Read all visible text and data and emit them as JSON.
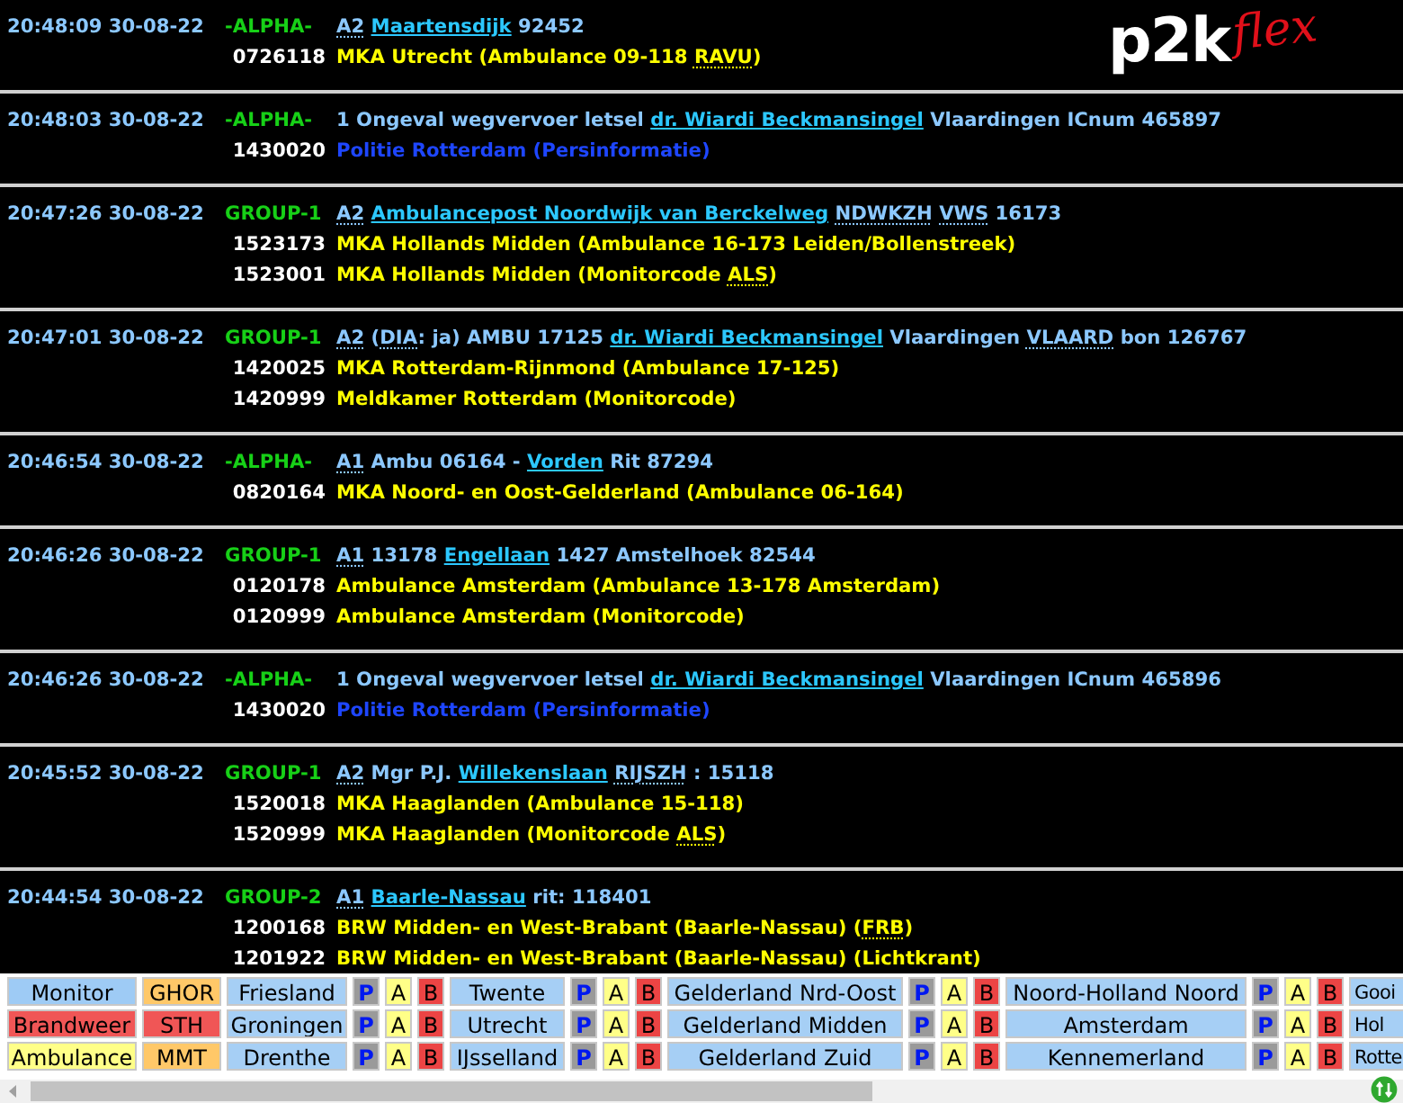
{
  "logo": {
    "main": "p2k",
    "accent": "flex"
  },
  "messages": [
    {
      "time": "20:48:09 30-08-22",
      "group": "-ALPHA-",
      "segments": [
        {
          "kind": "abbr",
          "text": "A2"
        },
        {
          "kind": "link",
          "text": "Maartensdijk"
        },
        {
          "kind": "text",
          "text": "92452"
        }
      ],
      "recipients": [
        {
          "code": "0726118",
          "color": "#ffff00",
          "segments": [
            {
              "kind": "text",
              "text": "MKA Utrecht (Ambulance 09-118"
            },
            {
              "kind": "abbr",
              "text": "RAVU",
              "after": ")"
            }
          ]
        }
      ]
    },
    {
      "time": "20:48:03 30-08-22",
      "group": "-ALPHA-",
      "segments": [
        {
          "kind": "text",
          "text": "1 Ongeval wegvervoer letsel"
        },
        {
          "kind": "link",
          "text": "dr. Wiardi Beckmansingel"
        },
        {
          "kind": "text",
          "text": "Vlaardingen ICnum 465897"
        }
      ],
      "recipients": [
        {
          "code": "1430020",
          "color": "#1e46ff",
          "segments": [
            {
              "kind": "text",
              "text": "Politie Rotterdam (Persinformatie)"
            }
          ]
        }
      ]
    },
    {
      "time": "20:47:26 30-08-22",
      "group": "GROUP-1",
      "segments": [
        {
          "kind": "abbr",
          "text": "A2"
        },
        {
          "kind": "link",
          "text": "Ambulancepost Noordwijk van Berckelweg"
        },
        {
          "kind": "abbr",
          "text": "NDWKZH"
        },
        {
          "kind": "abbr",
          "text": "VWS"
        },
        {
          "kind": "text",
          "text": "16173"
        }
      ],
      "recipients": [
        {
          "code": "1523173",
          "color": "#ffff00",
          "segments": [
            {
              "kind": "text",
              "text": "MKA Hollands Midden (Ambulance 16-173 Leiden/Bollenstreek)"
            }
          ]
        },
        {
          "code": "1523001",
          "color": "#ffff00",
          "segments": [
            {
              "kind": "text",
              "text": "MKA Hollands Midden (Monitorcode"
            },
            {
              "kind": "abbr",
              "text": "ALS",
              "after": ")"
            }
          ]
        }
      ]
    },
    {
      "time": "20:47:01 30-08-22",
      "group": "GROUP-1",
      "segments": [
        {
          "kind": "abbr",
          "text": "A2"
        },
        {
          "kind": "abbr",
          "text": "DIA",
          "before": "(",
          "after": ": ja) AMBU 17125"
        },
        {
          "kind": "link",
          "text": "dr. Wiardi Beckmansingel"
        },
        {
          "kind": "text",
          "text": "Vlaardingen"
        },
        {
          "kind": "abbr",
          "text": "VLAARD"
        },
        {
          "kind": "text",
          "text": "bon 126767"
        }
      ],
      "recipients": [
        {
          "code": "1420025",
          "color": "#ffff00",
          "segments": [
            {
              "kind": "text",
              "text": "MKA Rotterdam-Rijnmond (Ambulance 17-125)"
            }
          ]
        },
        {
          "code": "1420999",
          "color": "#ffff00",
          "segments": [
            {
              "kind": "text",
              "text": "Meldkamer Rotterdam (Monitorcode)"
            }
          ]
        }
      ]
    },
    {
      "time": "20:46:54 30-08-22",
      "group": "-ALPHA-",
      "segments": [
        {
          "kind": "abbr",
          "text": "A1"
        },
        {
          "kind": "text",
          "text": "Ambu 06164 -"
        },
        {
          "kind": "link",
          "text": "Vorden"
        },
        {
          "kind": "text",
          "text": "Rit 87294"
        }
      ],
      "recipients": [
        {
          "code": "0820164",
          "color": "#ffff00",
          "segments": [
            {
              "kind": "text",
              "text": "MKA Noord- en Oost-Gelderland (Ambulance 06-164)"
            }
          ]
        }
      ]
    },
    {
      "time": "20:46:26 30-08-22",
      "group": "GROUP-1",
      "segments": [
        {
          "kind": "abbr",
          "text": "A1"
        },
        {
          "kind": "text",
          "text": "13178"
        },
        {
          "kind": "link",
          "text": "Engellaan"
        },
        {
          "kind": "text",
          "text": "1427 Amstelhoek 82544"
        }
      ],
      "recipients": [
        {
          "code": "0120178",
          "color": "#ffff00",
          "segments": [
            {
              "kind": "text",
              "text": "Ambulance Amsterdam (Ambulance 13-178 Amsterdam)"
            }
          ]
        },
        {
          "code": "0120999",
          "color": "#ffff00",
          "segments": [
            {
              "kind": "text",
              "text": "Ambulance Amsterdam (Monitorcode)"
            }
          ]
        }
      ]
    },
    {
      "time": "20:46:26 30-08-22",
      "group": "-ALPHA-",
      "segments": [
        {
          "kind": "text",
          "text": "1 Ongeval wegvervoer letsel"
        },
        {
          "kind": "link",
          "text": "dr. Wiardi Beckmansingel"
        },
        {
          "kind": "text",
          "text": "Vlaardingen ICnum 465896"
        }
      ],
      "recipients": [
        {
          "code": "1430020",
          "color": "#1e46ff",
          "segments": [
            {
              "kind": "text",
              "text": "Politie Rotterdam (Persinformatie)"
            }
          ]
        }
      ]
    },
    {
      "time": "20:45:52 30-08-22",
      "group": "GROUP-1",
      "segments": [
        {
          "kind": "abbr",
          "text": "A2"
        },
        {
          "kind": "text",
          "text": "Mgr P.J."
        },
        {
          "kind": "link",
          "text": "Willekenslaan"
        },
        {
          "kind": "abbr",
          "text": "RIJSZH"
        },
        {
          "kind": "text",
          "text": ": 15118"
        }
      ],
      "recipients": [
        {
          "code": "1520018",
          "color": "#ffff00",
          "segments": [
            {
              "kind": "text",
              "text": "MKA Haaglanden (Ambulance 15-118)"
            }
          ]
        },
        {
          "code": "1520999",
          "color": "#ffff00",
          "segments": [
            {
              "kind": "text",
              "text": "MKA Haaglanden (Monitorcode"
            },
            {
              "kind": "abbr",
              "text": "ALS",
              "after": ")"
            }
          ]
        }
      ]
    },
    {
      "time": "20:44:54 30-08-22",
      "group": "GROUP-2",
      "segments": [
        {
          "kind": "abbr",
          "text": "A1"
        },
        {
          "kind": "link",
          "text": "Baarle-Nassau"
        },
        {
          "kind": "text",
          "text": "rit: 118401"
        }
      ],
      "recipients": [
        {
          "code": "1200168",
          "color": "#ffff00",
          "segments": [
            {
              "kind": "text",
              "text": "BRW Midden- en West-Brabant (Baarle-Nassau)"
            },
            {
              "kind": "abbr",
              "text": "FRB",
              "before": "(",
              "after": ")"
            }
          ]
        },
        {
          "code": "1201922",
          "color": "#ffff00",
          "segments": [
            {
              "kind": "text",
              "text": "BRW Midden- en West-Brabant (Baarle-Nassau) (Lichtkrant)"
            }
          ]
        }
      ]
    }
  ],
  "filters": [
    [
      {
        "kind": "monitor",
        "label": "Monitor"
      },
      {
        "kind": "ghor",
        "label": "GHOR"
      },
      {
        "kind": "region",
        "label": "Friesland"
      },
      {
        "kind": "p",
        "label": "P"
      },
      {
        "kind": "a",
        "label": "A"
      },
      {
        "kind": "b",
        "label": "B"
      },
      {
        "kind": "region",
        "label": "Twente"
      },
      {
        "kind": "p",
        "label": "P"
      },
      {
        "kind": "a",
        "label": "A"
      },
      {
        "kind": "b",
        "label": "B"
      },
      {
        "kind": "region",
        "label": "Gelderland Nrd-Oost"
      },
      {
        "kind": "p",
        "label": "P"
      },
      {
        "kind": "a",
        "label": "A"
      },
      {
        "kind": "b",
        "label": "B"
      },
      {
        "kind": "region",
        "label": "Noord-Holland Noord"
      },
      {
        "kind": "p",
        "label": "P"
      },
      {
        "kind": "a",
        "label": "A"
      },
      {
        "kind": "b",
        "label": "B"
      },
      {
        "kind": "cut",
        "label": "Gooi"
      }
    ],
    [
      {
        "kind": "brandweer",
        "label": "Brandweer"
      },
      {
        "kind": "sth",
        "label": "STH"
      },
      {
        "kind": "region",
        "label": "Groningen"
      },
      {
        "kind": "p",
        "label": "P"
      },
      {
        "kind": "a",
        "label": "A"
      },
      {
        "kind": "b",
        "label": "B"
      },
      {
        "kind": "region",
        "label": "Utrecht"
      },
      {
        "kind": "p",
        "label": "P"
      },
      {
        "kind": "a",
        "label": "A"
      },
      {
        "kind": "b",
        "label": "B"
      },
      {
        "kind": "region",
        "label": "Gelderland Midden"
      },
      {
        "kind": "p",
        "label": "P"
      },
      {
        "kind": "a",
        "label": "A"
      },
      {
        "kind": "b",
        "label": "B"
      },
      {
        "kind": "region",
        "label": "Amsterdam"
      },
      {
        "kind": "p",
        "label": "P"
      },
      {
        "kind": "a",
        "label": "A"
      },
      {
        "kind": "b",
        "label": "B"
      },
      {
        "kind": "cut",
        "label": "Hol"
      }
    ],
    [
      {
        "kind": "ambulance",
        "label": "Ambulance"
      },
      {
        "kind": "mmt",
        "label": "MMT"
      },
      {
        "kind": "region",
        "label": "Drenthe"
      },
      {
        "kind": "p",
        "label": "P"
      },
      {
        "kind": "a",
        "label": "A"
      },
      {
        "kind": "b",
        "label": "B"
      },
      {
        "kind": "region",
        "label": "IJsselland"
      },
      {
        "kind": "p",
        "label": "P"
      },
      {
        "kind": "a",
        "label": "A"
      },
      {
        "kind": "b",
        "label": "B"
      },
      {
        "kind": "region",
        "label": "Gelderland Zuid"
      },
      {
        "kind": "p",
        "label": "P"
      },
      {
        "kind": "a",
        "label": "A"
      },
      {
        "kind": "b",
        "label": "B"
      },
      {
        "kind": "region",
        "label": "Kennemerland"
      },
      {
        "kind": "p",
        "label": "P"
      },
      {
        "kind": "a",
        "label": "A"
      },
      {
        "kind": "b",
        "label": "B"
      },
      {
        "kind": "cut",
        "label": "Rotte"
      }
    ]
  ]
}
